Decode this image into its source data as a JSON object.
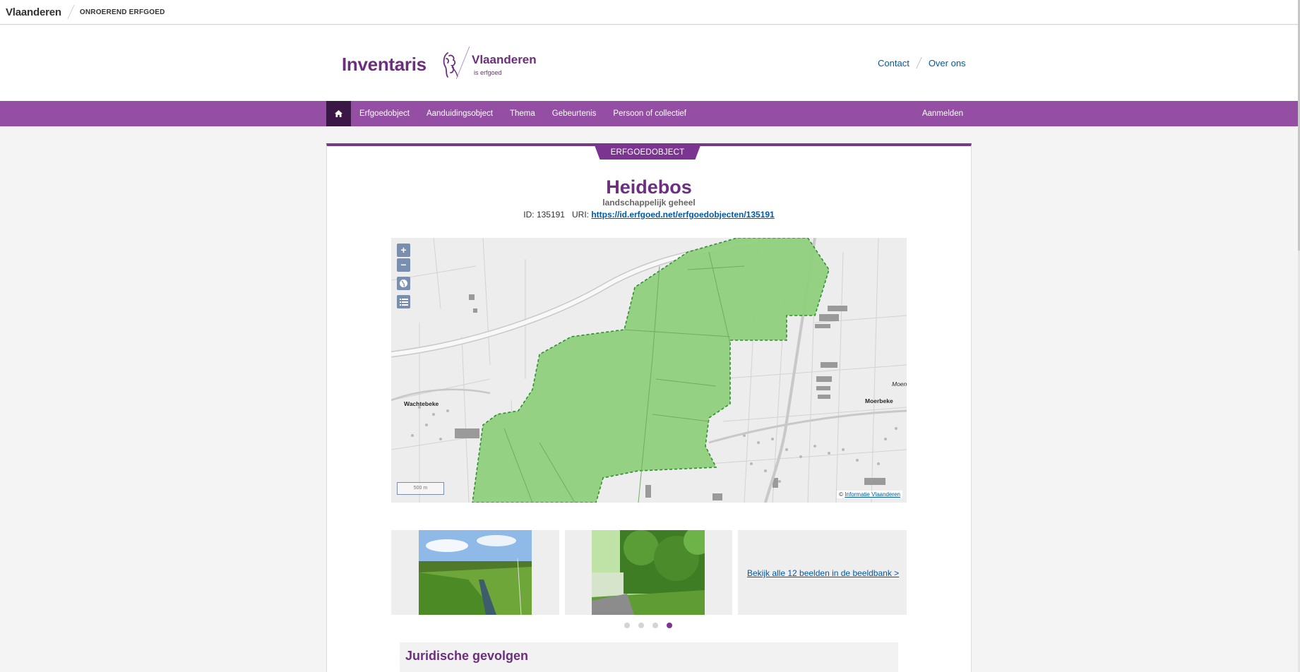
{
  "topbar": {
    "brand": "Vlaanderen",
    "sub": "ONROEREND ERFGOED"
  },
  "header": {
    "app_title": "Inventaris",
    "logo_text": "Vlaanderen",
    "logo_sub": "is erfgoed",
    "links": [
      "Contact",
      "Over ons"
    ]
  },
  "nav": {
    "items": [
      "Erfgoedobject",
      "Aanduidingsobject",
      "Thema",
      "Gebeurtenis",
      "Persoon of collectief"
    ],
    "login": "Aanmelden"
  },
  "record": {
    "tab": "ERFGOEDOBJECT",
    "title": "Heidebos",
    "type": "landschappelijk geheel",
    "id_label": "ID:",
    "id": "135191",
    "uri_label": "URI:",
    "uri": "https://id.erfgoed.net/erfgoedobjecten/135191"
  },
  "map": {
    "controls": [
      "+",
      "−"
    ],
    "scale": "500 m",
    "attribution_prefix": "©",
    "attribution_link": "Informatie Vlaanderen",
    "places": [
      "Wachtebeke",
      "Moerbeke",
      "Moen"
    ],
    "colors": {
      "polygon_fill": "#8fd07c",
      "polygon_stroke": "#2f8f2f"
    }
  },
  "gallery": {
    "more_link": "Bekijk alle 12 beelden in de beeldbank >",
    "dots": 4,
    "active_dot": 4
  },
  "sections": {
    "legal": "Juridische gevolgen"
  },
  "colors": {
    "brand": "#6c2e7e",
    "nav": "#944ea3",
    "link": "#0059a7"
  }
}
